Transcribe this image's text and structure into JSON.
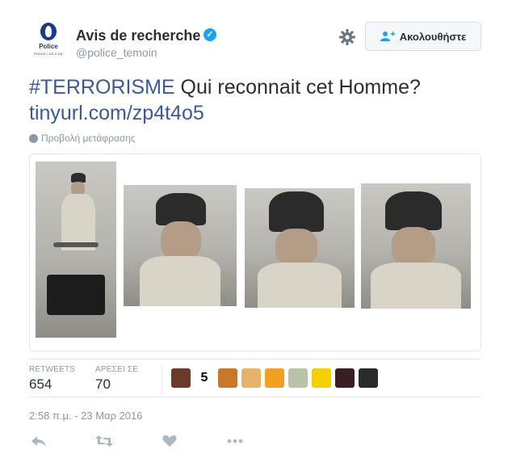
{
  "account": {
    "logo_text": "Police",
    "logo_sub": "POLICE / 101 2 101",
    "name": "Avis de recherche",
    "verified_mark": "✓",
    "handle": "@police_temoin"
  },
  "header": {
    "follow_label": "Ακολουθήστε",
    "settings_icon": "gear-icon",
    "follow_icon": "add-user-icon"
  },
  "tweet": {
    "hashtag": "#TERRORISME",
    "text": " Qui reconnait cet Homme?",
    "link": "tinyurl.com/zp4t4o5",
    "translate_label": "Προβολή μετάφρασης"
  },
  "stats": {
    "retweets_label": "RETWEETS",
    "retweets_value": "654",
    "likes_label": "ΑΡΕΣΕΙ ΣΕ",
    "likes_value": "70"
  },
  "likers": [
    {
      "name": "liker-1",
      "color": "#6b3a2a"
    },
    {
      "name": "liker-2",
      "color": "#ffffff",
      "text": "5"
    },
    {
      "name": "liker-3",
      "color": "#c8782a"
    },
    {
      "name": "liker-4",
      "color": "#e7b36a"
    },
    {
      "name": "liker-5",
      "color": "#f2a020"
    },
    {
      "name": "liker-6",
      "color": "#b9c3a8"
    },
    {
      "name": "liker-7",
      "color": "#f5d000"
    },
    {
      "name": "liker-8",
      "color": "#3a1e22"
    },
    {
      "name": "liker-9",
      "color": "#2b2b2b"
    }
  ],
  "timestamp": "2:58 π.μ. - 23 Μαρ 2016",
  "actions": [
    "reply-icon",
    "retweet-icon",
    "like-icon",
    "more-icon"
  ],
  "colors": {
    "link": "#3b5998",
    "muted": "#8899a6",
    "verified": "#1da1f2",
    "border": "#e1e8ed"
  }
}
